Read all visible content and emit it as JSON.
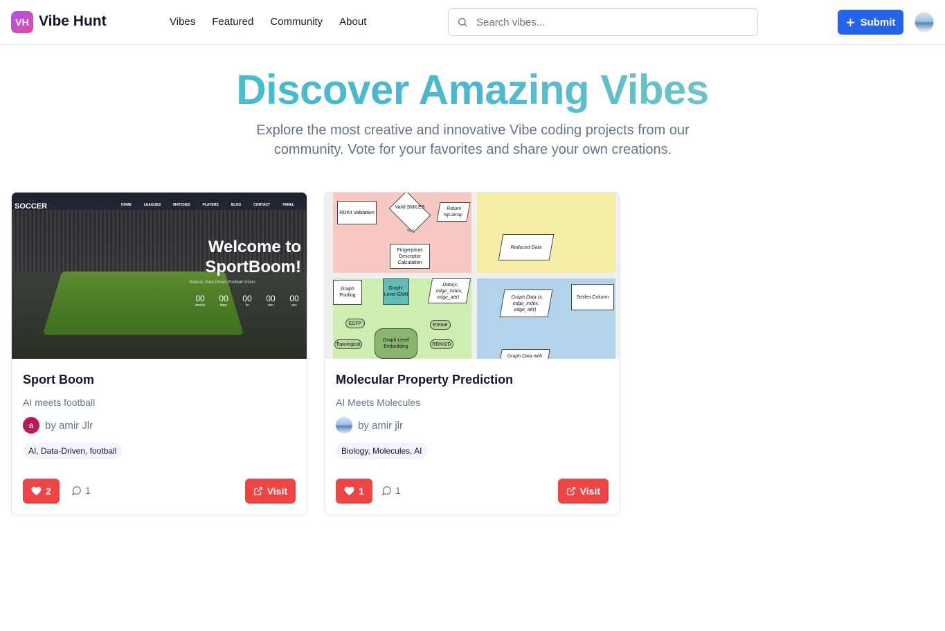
{
  "header": {
    "logo_badge": "VH",
    "logo_text": "Vibe Hunt",
    "nav": [
      "Vibes",
      "Featured",
      "Community",
      "About"
    ],
    "search_placeholder": "Search vibes...",
    "submit_label": "Submit"
  },
  "hero": {
    "title": "Discover Amazing Vibes",
    "subtitle": "Explore the most creative and innovative Vibe coding projects from our community. Vote for your favorites and share your own creations."
  },
  "cards": [
    {
      "title": "Sport Boom",
      "subtitle": "AI meets football",
      "author": "by amir Jlr",
      "author_initial": "a",
      "tags": "AI, Data-Driven, football",
      "likes": "2",
      "comments": "1",
      "visit_label": "Visit",
      "preview": {
        "brand": "SOCCER",
        "nav": [
          "HOME",
          "LEAGUES",
          "MATCHES",
          "PLAYERS",
          "BLOG",
          "CONTACT",
          "PANEL"
        ],
        "welcome": "Welcome to SportBoom!",
        "tagline": "Statical, Data Driven Football Vision",
        "countdown": [
          {
            "n": "00",
            "u": "weeks"
          },
          {
            "n": "00",
            "u": "days"
          },
          {
            "n": "00",
            "u": "hr"
          },
          {
            "n": "00",
            "u": "min"
          },
          {
            "n": "00",
            "u": "sec"
          }
        ]
      }
    },
    {
      "title": "Molecular Property Prediction",
      "subtitle": "AI Meets Molecules",
      "author": "by amir jlr",
      "tags": "Biology, Molecules, AI",
      "likes": "1",
      "comments": "1",
      "visit_label": "Visit",
      "preview": {
        "rdkit": "RDKit Validation",
        "valid": "Valid SMILES",
        "yes": "Yes",
        "return": "Return Np.array",
        "fingerprints": "Fingerprints Descriptor Calculation",
        "reduced": "Reduced Data",
        "graph_pooling": "Graph Pooling",
        "graph_level_gnn": "Graph-Level-GNN",
        "data_edge": "Data(x, edge_index, edge_attr)",
        "graph_data": "Graph Data (x, edge_index, edge_attr)",
        "smiles_column": "Smiles Column",
        "ecfp": "ECFP",
        "estate": "EState",
        "topological": "Topological",
        "graph_level_embedding": "Graph Level Embedding",
        "rdkit2d": "RDKit2D",
        "graph_data_with": "Graph Data with"
      }
    }
  ],
  "colors": {
    "primary": "#2563eb",
    "like": "#ef4444",
    "muted": "#64748b"
  }
}
